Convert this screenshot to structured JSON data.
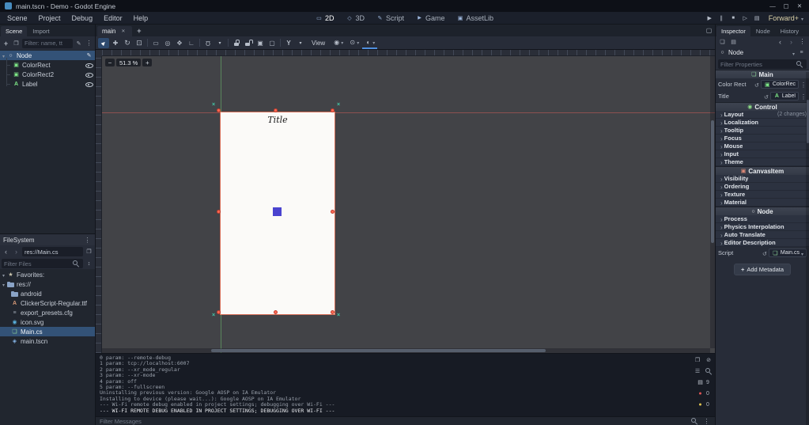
{
  "titlebar": {
    "title": "main.tscn - Demo - Godot Engine",
    "minimize_glyph": "—",
    "maximize_glyph": "▢",
    "close_glyph": "✕"
  },
  "menubar": {
    "menus": [
      "Scene",
      "Project",
      "Debug",
      "Editor",
      "Help"
    ],
    "workspaces": [
      {
        "label": "2D",
        "icon": "ws2d",
        "active": true
      },
      {
        "label": "3D",
        "icon": "ws3d"
      },
      {
        "label": "Script",
        "icon": "wsscript"
      },
      {
        "label": "Game",
        "icon": "wsgame"
      },
      {
        "label": "AssetLib",
        "icon": "wsasset"
      }
    ],
    "playback": [
      "play",
      "pause",
      "stop",
      "playscene",
      "movie"
    ],
    "renderer": "Forward+"
  },
  "scene": {
    "tabs": [
      {
        "label": "Scene",
        "active": true
      },
      {
        "label": "Import"
      }
    ],
    "filter_placeholder": "Filter: name, tt",
    "nodes": [
      {
        "name": "Node",
        "icon": "node",
        "parent": true,
        "selected": true,
        "right": "script"
      },
      {
        "name": "ColorRect",
        "icon": "colorrect",
        "child": true,
        "right": "eye"
      },
      {
        "name": "ColorRect2",
        "icon": "colorrect",
        "child": true,
        "right": "eye"
      },
      {
        "name": "Label",
        "icon": "label",
        "child": true,
        "right": "eye"
      }
    ]
  },
  "filesystem": {
    "title": "FileSystem",
    "path": "res://Main.cs",
    "filter_placeholder": "Filter Files",
    "entries": [
      {
        "name": "Favorites:",
        "icon": "star",
        "caret": true
      },
      {
        "name": "res://",
        "icon": "folder",
        "caret": true
      },
      {
        "name": "android",
        "icon": "folder",
        "indent": true
      },
      {
        "name": "ClickerScript-Regular.ttf",
        "icon": "font",
        "indent": true
      },
      {
        "name": "export_presets.cfg",
        "icon": "cfg",
        "indent": true
      },
      {
        "name": "icon.svg",
        "icon": "svg",
        "indent": true
      },
      {
        "name": "Main.cs",
        "icon": "cs",
        "indent": true,
        "selected": true
      },
      {
        "name": "main.tscn",
        "icon": "tscn",
        "indent": true
      }
    ]
  },
  "viewport": {
    "tab_label": "main",
    "view_menu": "View",
    "zoom_label": "51.3 %",
    "canvas_text": "Title",
    "tools": [
      {
        "i": "select",
        "a": true
      },
      {
        "i": "move"
      },
      {
        "i": "rotate"
      },
      {
        "i": "scale"
      },
      {
        "i": "sep"
      },
      {
        "i": "listsel"
      },
      {
        "i": "pivot"
      },
      {
        "i": "pan"
      },
      {
        "i": "ruler"
      },
      {
        "i": "sep"
      },
      {
        "i": "magnet"
      },
      {
        "i": "caret"
      },
      {
        "i": "sep"
      },
      {
        "i": "lock"
      },
      {
        "i": "unlock"
      },
      {
        "i": "group"
      },
      {
        "i": "ungroup"
      },
      {
        "i": "sep"
      },
      {
        "i": "bone"
      },
      {
        "i": "caret"
      }
    ]
  },
  "inspector": {
    "tabs": [
      {
        "label": "Inspector",
        "active": true
      },
      {
        "label": "Node"
      },
      {
        "label": "History"
      }
    ],
    "node_name": "Node",
    "filter_placeholder": "Filter Properties",
    "rows": [
      {
        "type": "category",
        "label": "Main",
        "icon": "main"
      },
      {
        "type": "propnode",
        "label": "Color Rect",
        "value": "ColorRec",
        "vicon": "colorrect"
      },
      {
        "type": "propnode",
        "label": "Title",
        "value": "Label",
        "vicon": "label"
      },
      {
        "type": "category",
        "label": "Control",
        "icon": "control"
      },
      {
        "type": "group",
        "label": "Layout",
        "note": "(2 changes)"
      },
      {
        "type": "group",
        "label": "Localization"
      },
      {
        "type": "group",
        "label": "Tooltip"
      },
      {
        "type": "group",
        "label": "Focus"
      },
      {
        "type": "group",
        "label": "Mouse"
      },
      {
        "type": "group",
        "label": "Input"
      },
      {
        "type": "group",
        "label": "Theme"
      },
      {
        "type": "category",
        "label": "CanvasItem",
        "icon": "canvasitem"
      },
      {
        "type": "group",
        "label": "Visibility"
      },
      {
        "type": "group",
        "label": "Ordering"
      },
      {
        "type": "group",
        "label": "Texture"
      },
      {
        "type": "group",
        "label": "Material"
      },
      {
        "type": "category",
        "label": "Node",
        "icon": "node"
      },
      {
        "type": "group",
        "label": "Process"
      },
      {
        "type": "group",
        "label": "Physics Interpolation"
      },
      {
        "type": "group",
        "label": "Auto Translate"
      },
      {
        "type": "group",
        "label": "Editor Description"
      },
      {
        "type": "script",
        "label": "Script",
        "value": "Main.cs",
        "vicon": "cs"
      }
    ],
    "add_metadata_label": "Add Metadata"
  },
  "output": {
    "lines": [
      {
        "text": "0 param: --remote-debug"
      },
      {
        "text": "1 param: tcp://localhost:6007"
      },
      {
        "text": "2 param: --xr_mode_regular"
      },
      {
        "text": "3 param: --xr-mode"
      },
      {
        "text": "4 param: off"
      },
      {
        "text": "5 param: --fullscreen"
      },
      {
        "text": "Uninstalling previous version: Google AOSP on IA Emulator"
      },
      {
        "text": "Installing to device (please wait...): Google AOSP on IA Emulator"
      },
      {
        "text": "--- Wi-Fi remote debug enabled in project settings; debugging over Wi-Fi ---"
      },
      {
        "text": "--- WI-FI REMOTE DEBUG ENABLED IN PROJECT SETTINGS; DEBUGGING OVER WI-FI ---",
        "bright": true
      }
    ],
    "counts": {
      "messages": "9",
      "errors": "0",
      "warnings": "0"
    },
    "filter_placeholder": "Filter Messages"
  },
  "colors": {
    "accent_blue": "#4f8fde",
    "selection_blue": "#335277",
    "canvas_square": "#4a43cf",
    "axis_x_red": "#e05555",
    "axis_y_green": "#6bd06b",
    "handle_red": "#ff6a55",
    "anchor_teal": "#43c8a8",
    "godot_blue": "#478cbf",
    "control_green": "#8ee087",
    "canvasitem_red": "#e08a78"
  }
}
